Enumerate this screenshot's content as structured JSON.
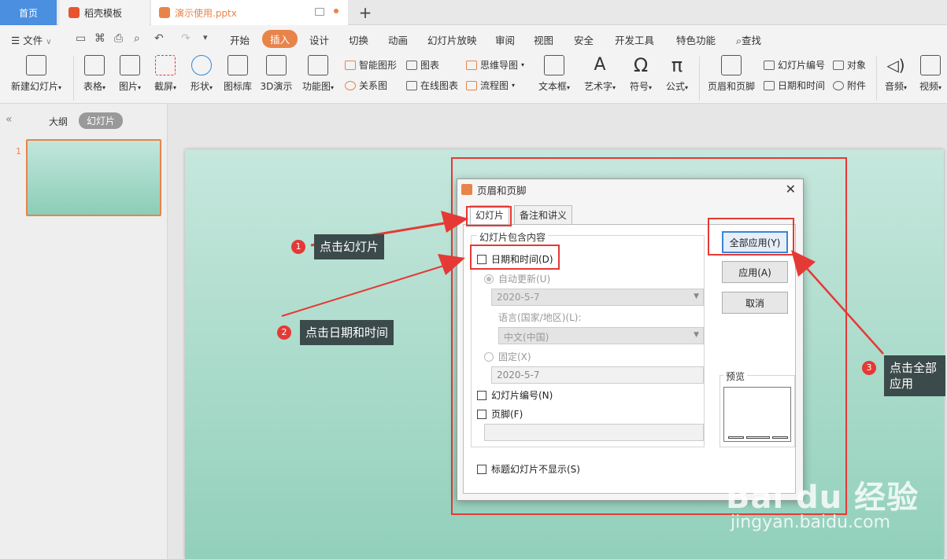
{
  "tabs": {
    "home": "首页",
    "template": "稻壳模板",
    "file": "演示使用.pptx",
    "add": "+"
  },
  "menubar": {
    "file_menu": "文件",
    "items": [
      "开始",
      "插入",
      "设计",
      "切换",
      "动画",
      "幻灯片放映",
      "审阅",
      "视图",
      "安全",
      "开发工具",
      "特色功能"
    ],
    "active": "插入",
    "search": "查找"
  },
  "ribbon": {
    "new_slide": "新建幻灯片",
    "table": "表格",
    "image": "图片",
    "screenshot": "截屏",
    "shape": "形状",
    "icon_lib": "图标库",
    "demo3d": "3D演示",
    "func_chart": "功能图",
    "smart_shape": "智能图形",
    "chart": "图表",
    "mind_map": "思维导图",
    "relation": "关系图",
    "online_chart": "在线图表",
    "flowchart": "流程图",
    "textbox": "文本框",
    "wordart": "艺术字",
    "symbol": "符号",
    "formula": "公式",
    "header_footer": "页眉和页脚",
    "slide_number": "幻灯片编号",
    "object": "对象",
    "date_time": "日期和时间",
    "attachment": "附件",
    "audio": "音频",
    "video": "视频"
  },
  "leftpanel": {
    "outline": "大纲",
    "slides": "幻灯片",
    "thumb_number": "1"
  },
  "dialog": {
    "title": "页眉和页脚",
    "tab_slide": "幻灯片",
    "tab_notes": "备注和讲义",
    "group_label": "幻灯片包含内容",
    "date_time": "日期和时间(D)",
    "auto_update": "自动更新(U)",
    "auto_date": "2020-5-7",
    "language_label": "语言(国家/地区)(L):",
    "language": "中文(中国)",
    "fixed": "固定(X)",
    "fixed_date": "2020-5-7",
    "slide_number": "幻灯片编号(N)",
    "footer": "页脚(F)",
    "no_title_slide": "标题幻灯片不显示(S)",
    "apply_all": "全部应用(Y)",
    "apply": "应用(A)",
    "cancel": "取消",
    "preview": "预览"
  },
  "callouts": {
    "c1_num": "1",
    "c1_text": "点击幻灯片",
    "c2_num": "2",
    "c2_text": "点击日期和时间",
    "c3_num": "3",
    "c3_line1": "点击全部",
    "c3_line2": "应用"
  },
  "watermark": {
    "brand": "Bai du 经验",
    "url": "jingyan.baidu.com"
  },
  "colors": {
    "accent": "#e8844a",
    "annotation_red": "#e53935",
    "callout_bg": "#3b4a4a",
    "home_tab": "#4a8fe0"
  }
}
